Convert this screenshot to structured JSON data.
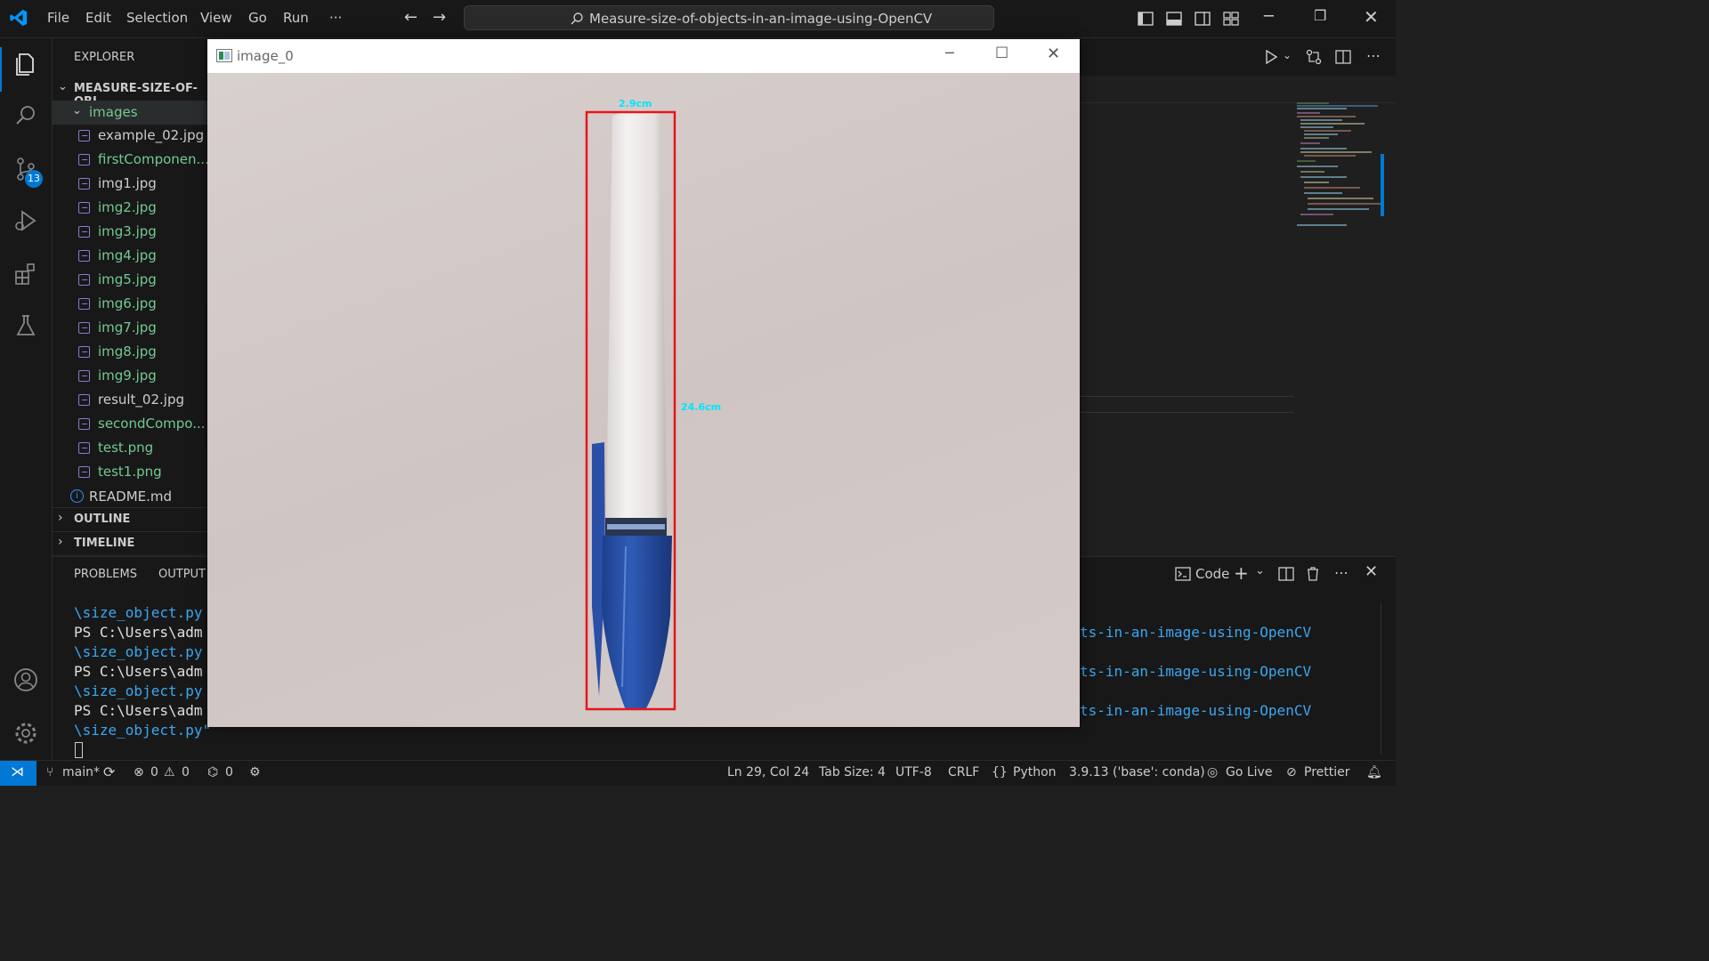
{
  "titlebar": {
    "menus": [
      "File",
      "Edit",
      "Selection",
      "View",
      "Go",
      "Run",
      "···"
    ],
    "command_center": "Measure-size-of-objects-in-an-image-using-OpenCV"
  },
  "activity": {
    "scm_badge": "13"
  },
  "explorer": {
    "header": "EXPLORER",
    "root": "MEASURE-SIZE-OF-OBJ",
    "folder": "images",
    "files": [
      {
        "name": "example_02.jpg",
        "color": "white"
      },
      {
        "name": "firstComponen...",
        "color": "green"
      },
      {
        "name": "img1.jpg",
        "color": "white"
      },
      {
        "name": "img2.jpg",
        "color": "green"
      },
      {
        "name": "img3.jpg",
        "color": "green"
      },
      {
        "name": "img4.jpg",
        "color": "green"
      },
      {
        "name": "img5.jpg",
        "color": "green"
      },
      {
        "name": "img6.jpg",
        "color": "green"
      },
      {
        "name": "img7.jpg",
        "color": "green"
      },
      {
        "name": "img8.jpg",
        "color": "green"
      },
      {
        "name": "img9.jpg",
        "color": "green"
      },
      {
        "name": "result_02.jpg",
        "color": "white"
      },
      {
        "name": "secondCompo...",
        "color": "green"
      },
      {
        "name": "test.png",
        "color": "green"
      },
      {
        "name": "test1.png",
        "color": "green"
      }
    ],
    "readme": "README.md",
    "outline": "OUTLINE",
    "timeline": "TIMELINE"
  },
  "panel": {
    "tabs": [
      "PROBLEMS",
      "OUTPUT"
    ],
    "terminal_profile": "Code",
    "lines_left": [
      "\\size_object.py",
      "PS C:\\Users\\adm",
      "\\size_object.py",
      "PS C:\\Users\\adm",
      "\\size_object.py",
      "PS C:\\Users\\adm",
      "\\size_object.py\""
    ],
    "lines_right": [
      "ts-in-an-image-using-OpenCV",
      "ts-in-an-image-using-OpenCV",
      "ts-in-an-image-using-OpenCV"
    ]
  },
  "cv_window": {
    "title": "image_0",
    "width_label": "2.9cm",
    "height_label": "24.6cm"
  },
  "statusbar": {
    "branch": "main*",
    "errors": "0",
    "warnings": "0",
    "ports": "0",
    "position": "Ln 29, Col 24",
    "tab_size": "Tab Size: 4",
    "encoding": "UTF-8",
    "eol": "CRLF",
    "language": "Python",
    "interpreter": "3.9.13 ('base': conda)",
    "go_live": "Go Live",
    "prettier": "Prettier"
  }
}
